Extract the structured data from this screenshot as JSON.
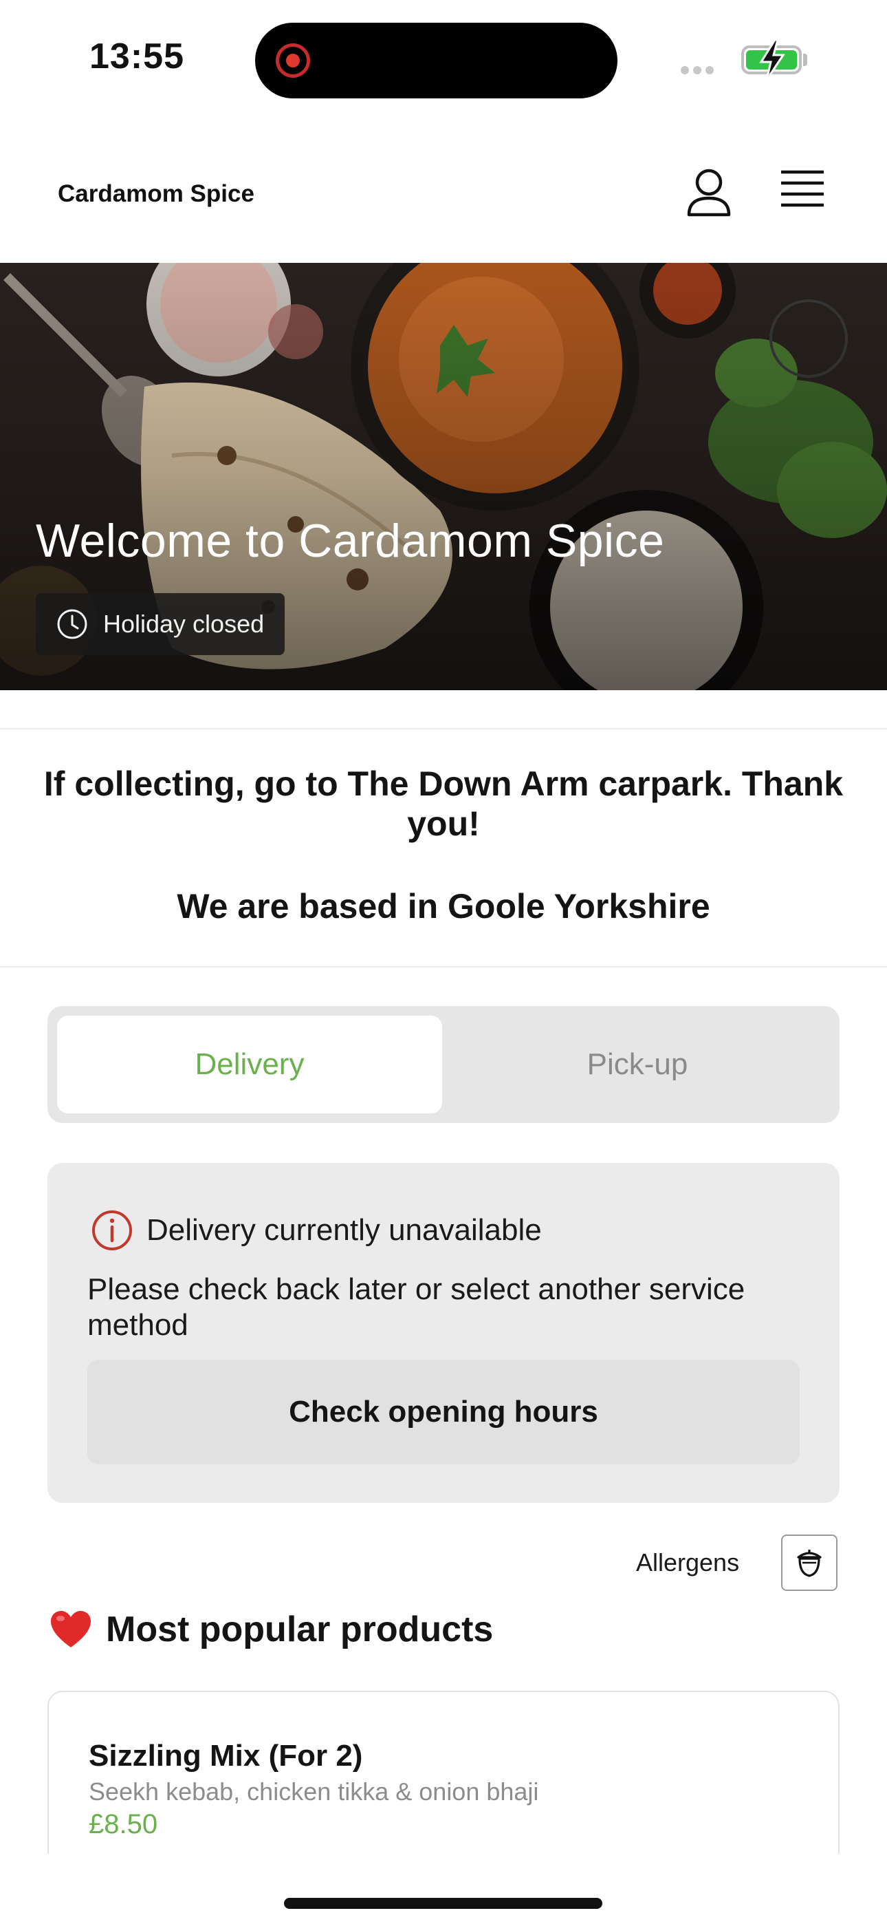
{
  "status_bar": {
    "time": "13:55",
    "battery_color": "#33c348",
    "recording_indicator_color": "#e0392f"
  },
  "header": {
    "brand": "Cardamom Spice",
    "account_icon": "person-icon",
    "menu_icon": "hamburger-menu-icon"
  },
  "hero": {
    "title": "Welcome to Cardamom Spice",
    "status": "Holiday closed",
    "status_icon": "clock-icon"
  },
  "info": {
    "collection_notice": "If collecting, go to The Down Arm carpark. Thank you!",
    "location_notice": "We are based in Goole Yorkshire"
  },
  "service_tabs": {
    "selected": "Delivery",
    "items": [
      {
        "label": "Delivery"
      },
      {
        "label": "Pick-up"
      }
    ],
    "accent_color": "#6ab04c"
  },
  "notice": {
    "icon": "info-circle-icon",
    "icon_color": "#c0392b",
    "title": "Delivery currently unavailable",
    "body": "Please check back later or select another service method",
    "button_label": "Check opening hours"
  },
  "allergens": {
    "label": "Allergens",
    "icon": "acorn-icon"
  },
  "popular": {
    "emoji_icon": "heart-icon",
    "heading": "Most popular products",
    "products": [
      {
        "name": "Sizzling Mix (For 2)",
        "description": "Seekh kebab, chicken tikka & onion bhaji",
        "price": "£8.50"
      }
    ]
  }
}
